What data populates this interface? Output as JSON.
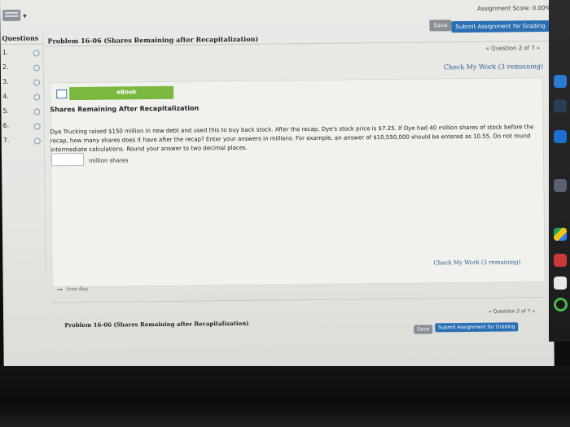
{
  "header": {
    "assignment_score": "Assignment Score: 0.00%",
    "save_label": "Save",
    "submit_label": "Submit Assignment for Grading",
    "menu_icon": "keyboard-icon"
  },
  "sidebar": {
    "title": "Questions",
    "items": [
      {
        "label": "1."
      },
      {
        "label": "2."
      },
      {
        "label": "3."
      },
      {
        "label": "4."
      },
      {
        "label": "5."
      },
      {
        "label": "6."
      },
      {
        "label": "7."
      }
    ]
  },
  "main": {
    "problem_title": "Problem 16-06 (Shares Remaining after Recapitalization)",
    "question_nav": "« Question 2 of 7 »",
    "check_my_work": "Check My Work (3 remaining)",
    "ebook_label": "eBook",
    "section_heading": "Shares Remaining After Recapitalization",
    "question_text": "Dye Trucking raised $150 million in new debt and used this to buy back stock. After the recap, Dye's stock price is $7.25. If Dye had 40 million shares of stock before the recap, how many shares does it have after the recap? Enter your answers in millions. For example, an answer of $10,550,000 should be entered as 10.55. Do not round intermediate calculations. Round your answer to two decimal places.",
    "answer_value": "",
    "answer_unit": "million shares",
    "check_my_work_bottom": "Check My Work (3 remaining)",
    "icon_key_label": "Icon Key"
  },
  "footer": {
    "problem_title": "Problem 16-06 (Shares Remaining after Recapitalization)",
    "question_nav": "« Question 2 of 7 »",
    "save_label": "Save",
    "submit_label": "Submit Assignment for Grading"
  }
}
